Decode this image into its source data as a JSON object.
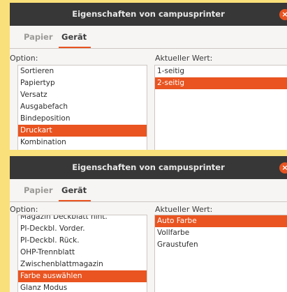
{
  "dialog1": {
    "title": "Eigenschaften von campusprinter",
    "close_glyph": "×",
    "tabs": [
      "Papier",
      "Gerät"
    ],
    "active_tab": "Gerät",
    "option_header": "Option:",
    "value_header": "Aktueller Wert:",
    "options": [
      "Sortieren",
      "Papiertyp",
      "Versatz",
      "Ausgabefach",
      "Bindeposition",
      "Druckart",
      "Kombination"
    ],
    "selected_option": "Druckart",
    "values": [
      "1-seitig",
      "2-seitig"
    ],
    "selected_value": "2-seitig"
  },
  "dialog2": {
    "title": "Eigenschaften von campusprinter",
    "close_glyph": "×",
    "tabs": [
      "Papier",
      "Gerät"
    ],
    "active_tab": "Gerät",
    "option_header": "Option:",
    "value_header": "Aktueller Wert:",
    "options": [
      "Magazin Deckblatt hint.",
      "PI-Deckbl. Vorder.",
      "PI-Deckbl. Rück.",
      "OHP-Trennblatt",
      "Zwischenblattmagazin",
      "Farbe auswählen",
      "Glanz Modus"
    ],
    "selected_option": "Farbe auswählen",
    "values": [
      "Auto Farbe",
      "Vollfarbe",
      "Graustufen"
    ],
    "selected_value": "Auto Farbe"
  },
  "colors": {
    "accent": "#e95420",
    "titlebar": "#373737",
    "background": "#f9e07a"
  }
}
